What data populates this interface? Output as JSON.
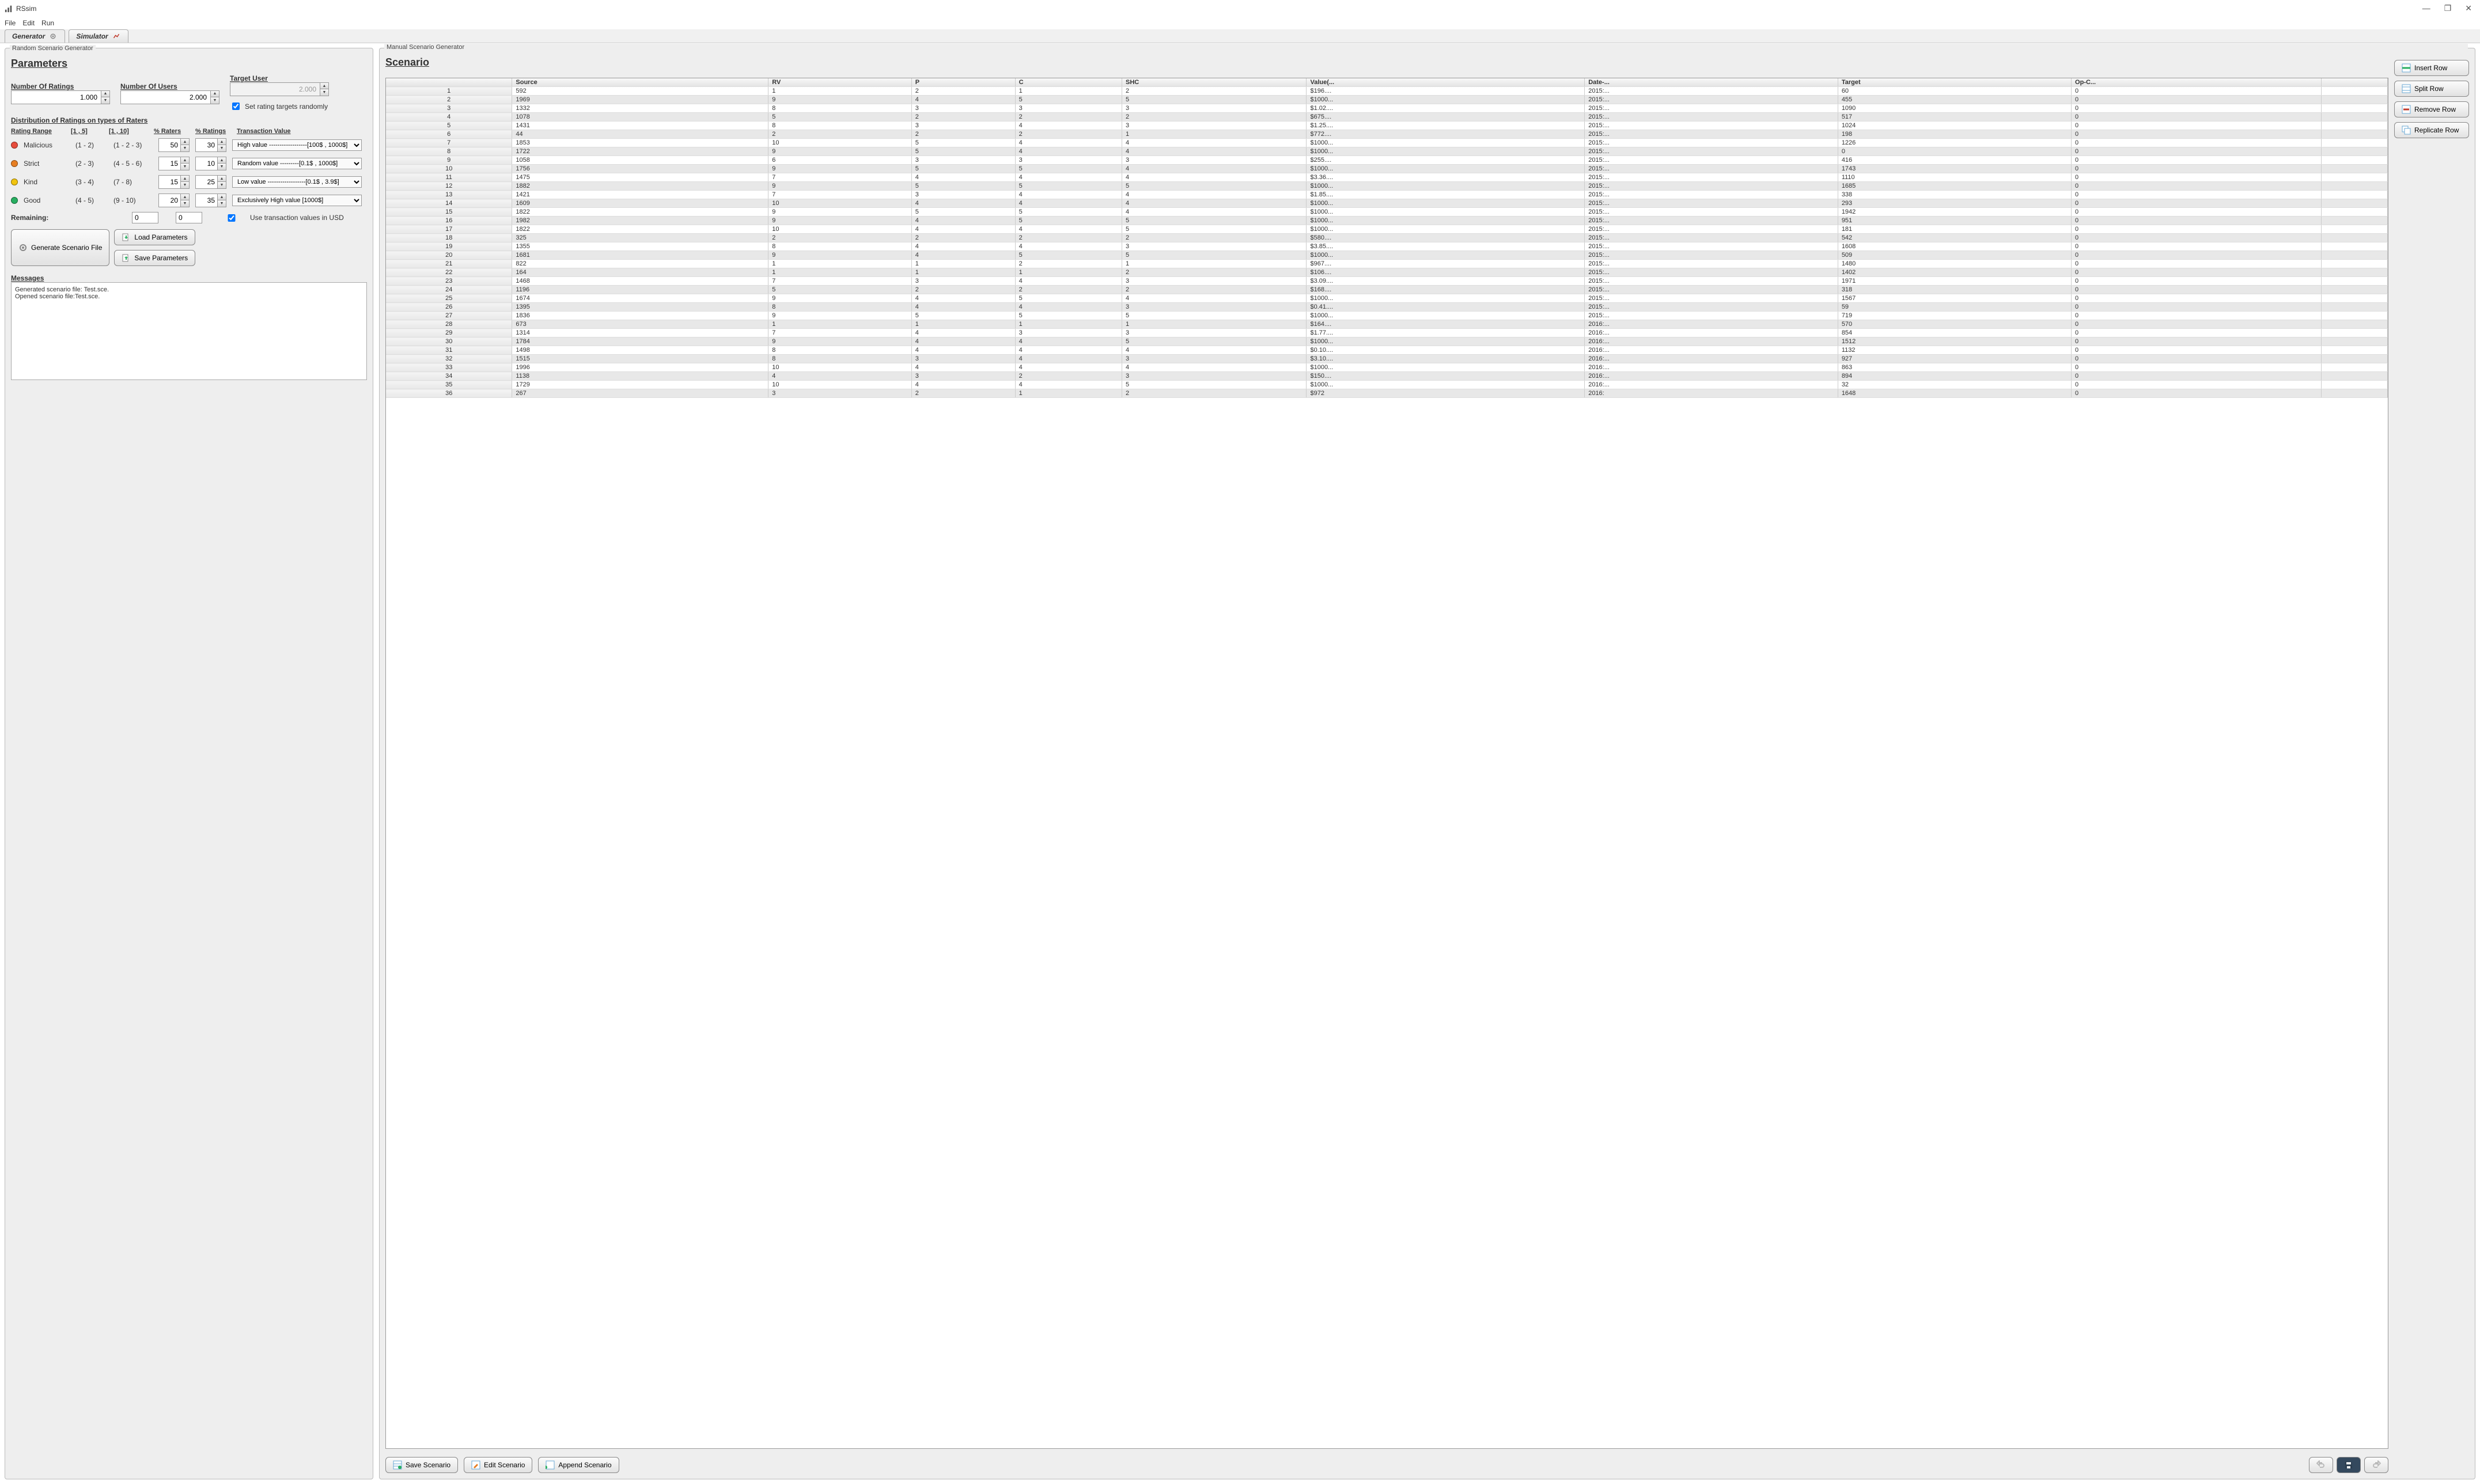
{
  "window": {
    "title": "RSsim"
  },
  "menu": {
    "file": "File",
    "edit": "Edit",
    "run": "Run"
  },
  "tabs": {
    "generator": "Generator",
    "simulator": "Simulator"
  },
  "left": {
    "group_title": "Random Scenario Generator",
    "heading": "Parameters",
    "num_ratings": {
      "label": "Number Of Ratings",
      "value": "1.000"
    },
    "num_users": {
      "label": "Number Of Users",
      "value": "2.000"
    },
    "target_user": {
      "label": "Target User",
      "value": "2.000"
    },
    "set_randomly": {
      "label": "Set rating targets randomly",
      "checked": true
    },
    "dist_heading": "Distribution of Ratings on types of Raters",
    "cols": {
      "range": "Rating Range",
      "r15": "[1 , 5]",
      "r110": "[1 , 10]",
      "pct_raters": "% Raters",
      "pct_ratings": "% Ratings",
      "trans": "Transaction Value"
    },
    "rows": [
      {
        "name": "Malicious",
        "r15": "(1 - 2)",
        "r110": "(1 - 2 - 3)",
        "raters": "50",
        "ratings": "30",
        "trans": "High value ------------------[100$ , 1000$]",
        "dot": "red"
      },
      {
        "name": "Strict",
        "r15": "(2 - 3)",
        "r110": "(4 - 5 - 6)",
        "raters": "15",
        "ratings": "10",
        "trans": "Random value ---------[0.1$ , 1000$]",
        "dot": "orange"
      },
      {
        "name": "Kind",
        "r15": "(3 - 4)",
        "r110": "(7 - 8)",
        "raters": "15",
        "ratings": "25",
        "trans": "Low value ------------------[0.1$ , 3.9$]",
        "dot": "yellow"
      },
      {
        "name": "Good",
        "r15": "(4 - 5)",
        "r110": "(9 - 10)",
        "raters": "20",
        "ratings": "35",
        "trans": "Exclusively High value [1000$]",
        "dot": "green"
      }
    ],
    "remaining": {
      "label": "Remaining:",
      "v1": "0",
      "v2": "0"
    },
    "use_usd": {
      "label": "Use transaction values in USD",
      "checked": true
    },
    "buttons": {
      "generate": "Generate Scenario File",
      "load": "Load Parameters",
      "save": "Save Parameters"
    },
    "messages": {
      "label": "Messages",
      "lines": [
        "Generated scenario file: Test.sce.",
        "Opened scenario file:Test.sce."
      ]
    }
  },
  "right": {
    "group_title": "Manual Scenario Generator",
    "heading": "Scenario",
    "buttons": {
      "insert": "Insert Row",
      "split": "Split Row",
      "remove": "Remove Row",
      "replicate": "Replicate Row",
      "save": "Save Scenario",
      "edit": "Edit Scenario",
      "append": "Append Scenario"
    },
    "columns": [
      "",
      "Source",
      "RV",
      "P",
      "C",
      "SHC",
      "Value(...",
      "Date-...",
      "Target",
      "Op-C...",
      ""
    ],
    "rows": [
      {
        "n": 1,
        "source": 592,
        "rv": 1,
        "p": 2,
        "c": 1,
        "shc": 2,
        "value": "$196....",
        "date": "2015:...",
        "target": 60,
        "opc": 0
      },
      {
        "n": 2,
        "source": 1969,
        "rv": 9,
        "p": 4,
        "c": 5,
        "shc": 5,
        "value": "$1000...",
        "date": "2015:...",
        "target": 455,
        "opc": 0
      },
      {
        "n": 3,
        "source": 1332,
        "rv": 8,
        "p": 3,
        "c": 3,
        "shc": 3,
        "value": "$1.02....",
        "date": "2015:...",
        "target": 1090,
        "opc": 0
      },
      {
        "n": 4,
        "source": 1078,
        "rv": 5,
        "p": 2,
        "c": 2,
        "shc": 2,
        "value": "$675....",
        "date": "2015:...",
        "target": 517,
        "opc": 0
      },
      {
        "n": 5,
        "source": 1431,
        "rv": 8,
        "p": 3,
        "c": 4,
        "shc": 3,
        "value": "$1.25....",
        "date": "2015:...",
        "target": 1024,
        "opc": 0
      },
      {
        "n": 6,
        "source": 44,
        "rv": 2,
        "p": 2,
        "c": 2,
        "shc": 1,
        "value": "$772....",
        "date": "2015:...",
        "target": 198,
        "opc": 0
      },
      {
        "n": 7,
        "source": 1853,
        "rv": 10,
        "p": 5,
        "c": 4,
        "shc": 4,
        "value": "$1000...",
        "date": "2015:...",
        "target": 1226,
        "opc": 0
      },
      {
        "n": 8,
        "source": 1722,
        "rv": 9,
        "p": 5,
        "c": 4,
        "shc": 4,
        "value": "$1000...",
        "date": "2015:...",
        "target": 0,
        "opc": 0
      },
      {
        "n": 9,
        "source": 1058,
        "rv": 6,
        "p": 3,
        "c": 3,
        "shc": 3,
        "value": "$255....",
        "date": "2015:...",
        "target": 416,
        "opc": 0
      },
      {
        "n": 10,
        "source": 1756,
        "rv": 9,
        "p": 5,
        "c": 5,
        "shc": 4,
        "value": "$1000...",
        "date": "2015:...",
        "target": 1743,
        "opc": 0
      },
      {
        "n": 11,
        "source": 1475,
        "rv": 7,
        "p": 4,
        "c": 4,
        "shc": 4,
        "value": "$3.36....",
        "date": "2015:...",
        "target": 1110,
        "opc": 0
      },
      {
        "n": 12,
        "source": 1882,
        "rv": 9,
        "p": 5,
        "c": 5,
        "shc": 5,
        "value": "$1000...",
        "date": "2015:...",
        "target": 1685,
        "opc": 0
      },
      {
        "n": 13,
        "source": 1421,
        "rv": 7,
        "p": 3,
        "c": 4,
        "shc": 4,
        "value": "$1.85....",
        "date": "2015:...",
        "target": 338,
        "opc": 0
      },
      {
        "n": 14,
        "source": 1609,
        "rv": 10,
        "p": 4,
        "c": 4,
        "shc": 4,
        "value": "$1000...",
        "date": "2015:...",
        "target": 293,
        "opc": 0
      },
      {
        "n": 15,
        "source": 1822,
        "rv": 9,
        "p": 5,
        "c": 5,
        "shc": 4,
        "value": "$1000...",
        "date": "2015:...",
        "target": 1942,
        "opc": 0
      },
      {
        "n": 16,
        "source": 1982,
        "rv": 9,
        "p": 4,
        "c": 5,
        "shc": 5,
        "value": "$1000...",
        "date": "2015:...",
        "target": 951,
        "opc": 0
      },
      {
        "n": 17,
        "source": 1822,
        "rv": 10,
        "p": 4,
        "c": 4,
        "shc": 5,
        "value": "$1000...",
        "date": "2015:...",
        "target": 181,
        "opc": 0
      },
      {
        "n": 18,
        "source": 325,
        "rv": 2,
        "p": 2,
        "c": 2,
        "shc": 2,
        "value": "$580....",
        "date": "2015:...",
        "target": 542,
        "opc": 0
      },
      {
        "n": 19,
        "source": 1355,
        "rv": 8,
        "p": 4,
        "c": 4,
        "shc": 3,
        "value": "$3.85....",
        "date": "2015:...",
        "target": 1608,
        "opc": 0
      },
      {
        "n": 20,
        "source": 1681,
        "rv": 9,
        "p": 4,
        "c": 5,
        "shc": 5,
        "value": "$1000...",
        "date": "2015:...",
        "target": 509,
        "opc": 0
      },
      {
        "n": 21,
        "source": 822,
        "rv": 1,
        "p": 1,
        "c": 2,
        "shc": 1,
        "value": "$967....",
        "date": "2015:...",
        "target": 1480,
        "opc": 0
      },
      {
        "n": 22,
        "source": 164,
        "rv": 1,
        "p": 1,
        "c": 1,
        "shc": 2,
        "value": "$106....",
        "date": "2015:...",
        "target": 1402,
        "opc": 0
      },
      {
        "n": 23,
        "source": 1468,
        "rv": 7,
        "p": 3,
        "c": 4,
        "shc": 3,
        "value": "$3.09....",
        "date": "2015:...",
        "target": 1971,
        "opc": 0
      },
      {
        "n": 24,
        "source": 1196,
        "rv": 5,
        "p": 2,
        "c": 2,
        "shc": 2,
        "value": "$168....",
        "date": "2015:...",
        "target": 318,
        "opc": 0
      },
      {
        "n": 25,
        "source": 1674,
        "rv": 9,
        "p": 4,
        "c": 5,
        "shc": 4,
        "value": "$1000...",
        "date": "2015:...",
        "target": 1567,
        "opc": 0
      },
      {
        "n": 26,
        "source": 1395,
        "rv": 8,
        "p": 4,
        "c": 4,
        "shc": 3,
        "value": "$0.41....",
        "date": "2015:...",
        "target": 59,
        "opc": 0
      },
      {
        "n": 27,
        "source": 1836,
        "rv": 9,
        "p": 5,
        "c": 5,
        "shc": 5,
        "value": "$1000...",
        "date": "2015:...",
        "target": 719,
        "opc": 0
      },
      {
        "n": 28,
        "source": 673,
        "rv": 1,
        "p": 1,
        "c": 1,
        "shc": 1,
        "value": "$164....",
        "date": "2016:...",
        "target": 570,
        "opc": 0
      },
      {
        "n": 29,
        "source": 1314,
        "rv": 7,
        "p": 4,
        "c": 3,
        "shc": 3,
        "value": "$1.77....",
        "date": "2016:...",
        "target": 854,
        "opc": 0
      },
      {
        "n": 30,
        "source": 1784,
        "rv": 9,
        "p": 4,
        "c": 4,
        "shc": 5,
        "value": "$1000...",
        "date": "2016:...",
        "target": 1512,
        "opc": 0
      },
      {
        "n": 31,
        "source": 1498,
        "rv": 8,
        "p": 4,
        "c": 4,
        "shc": 4,
        "value": "$0.10....",
        "date": "2016:...",
        "target": 1132,
        "opc": 0
      },
      {
        "n": 32,
        "source": 1515,
        "rv": 8,
        "p": 3,
        "c": 4,
        "shc": 3,
        "value": "$3.10....",
        "date": "2016:...",
        "target": 927,
        "opc": 0
      },
      {
        "n": 33,
        "source": 1996,
        "rv": 10,
        "p": 4,
        "c": 4,
        "shc": 4,
        "value": "$1000...",
        "date": "2016:...",
        "target": 863,
        "opc": 0
      },
      {
        "n": 34,
        "source": 1138,
        "rv": 4,
        "p": 3,
        "c": 2,
        "shc": 3,
        "value": "$150....",
        "date": "2016:...",
        "target": 894,
        "opc": 0
      },
      {
        "n": 35,
        "source": 1729,
        "rv": 10,
        "p": 4,
        "c": 4,
        "shc": 5,
        "value": "$1000...",
        "date": "2016:...",
        "target": 32,
        "opc": 0
      },
      {
        "n": 36,
        "source": 267,
        "rv": 3,
        "p": 2,
        "c": 1,
        "shc": 2,
        "value": "$972",
        "date": "2016:",
        "target": 1648,
        "opc": 0
      }
    ]
  }
}
